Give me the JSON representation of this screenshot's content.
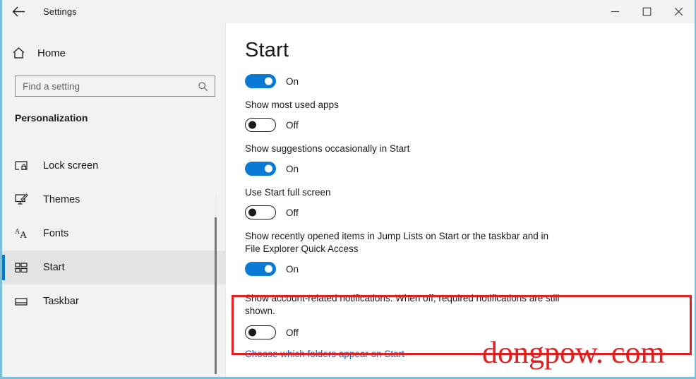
{
  "window": {
    "title": "Settings",
    "back_icon": "back-arrow-icon",
    "controls": {
      "minimize": "─",
      "maximize": "☐",
      "close": "✕"
    },
    "border_color": "#7cc0d8"
  },
  "sidebar": {
    "home": {
      "label": "Home",
      "icon": "home-icon"
    },
    "search": {
      "placeholder": "Find a setting",
      "value": "",
      "icon": "search-icon"
    },
    "section_title": "Personalization",
    "items": [
      {
        "label": "Lock screen",
        "icon": "lock-screen-icon",
        "selected": false
      },
      {
        "label": "Themes",
        "icon": "themes-brush-icon",
        "selected": false
      },
      {
        "label": "Fonts",
        "icon": "fonts-icon",
        "selected": false
      },
      {
        "label": "Start",
        "icon": "start-tiles-icon",
        "selected": true
      },
      {
        "label": "Taskbar",
        "icon": "taskbar-icon",
        "selected": false
      }
    ],
    "accent_color": "#0078d7",
    "background": "#f2f2f2"
  },
  "main": {
    "page_title": "Start",
    "settings": [
      {
        "label": "",
        "state": "On",
        "on": true
      },
      {
        "label": "Show most used apps",
        "state": "Off",
        "on": false
      },
      {
        "label": "Show suggestions occasionally in Start",
        "state": "On",
        "on": true
      },
      {
        "label": "Use Start full screen",
        "state": "Off",
        "on": false
      },
      {
        "label": "Show recently opened items in Jump Lists on Start or the taskbar and in File Explorer Quick Access",
        "state": "On",
        "on": true
      }
    ],
    "highlighted": {
      "label": "Show account-related notifications. When off, required notifications are still shown.",
      "state": "Off",
      "on": false,
      "highlight_color": "#e02020"
    },
    "folders_link": "Choose which folders appear on Start",
    "link_color": "#0066cc",
    "toggle_on_color": "#0a7ad5"
  },
  "watermark": {
    "text": "dongpow. com",
    "color": "#e02020"
  }
}
